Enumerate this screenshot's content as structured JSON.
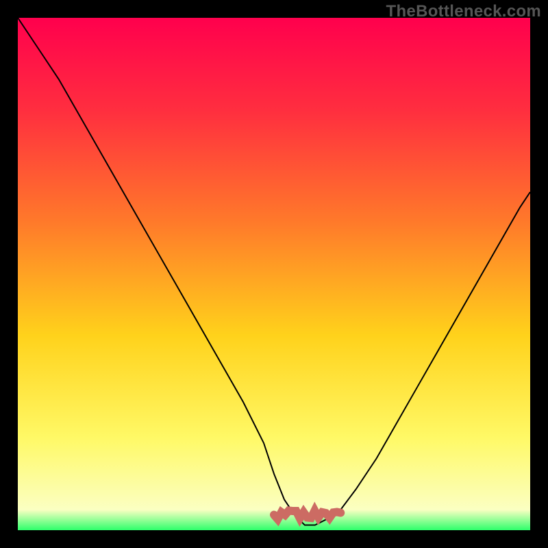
{
  "watermark": "TheBottleneck.com",
  "chart_data": {
    "type": "line",
    "title": "",
    "xlabel": "",
    "ylabel": "",
    "xlim": [
      0,
      100
    ],
    "ylim": [
      0,
      100
    ],
    "gradient_stops": [
      {
        "offset": 0,
        "color": "#ff004d"
      },
      {
        "offset": 18,
        "color": "#ff2e3f"
      },
      {
        "offset": 40,
        "color": "#ff7a2a"
      },
      {
        "offset": 62,
        "color": "#ffd21b"
      },
      {
        "offset": 82,
        "color": "#fff966"
      },
      {
        "offset": 96,
        "color": "#fbffc2"
      },
      {
        "offset": 100,
        "color": "#2dff6b"
      }
    ],
    "series": [
      {
        "name": "bottleneck-curve",
        "color": "#000000",
        "x": [
          0,
          4,
          8,
          12,
          16,
          20,
          24,
          28,
          32,
          36,
          40,
          44,
          48,
          50,
          52,
          54,
          56,
          58,
          60,
          63,
          66,
          70,
          74,
          78,
          82,
          86,
          90,
          94,
          98,
          100
        ],
        "y": [
          100,
          94,
          88,
          81,
          74,
          67,
          60,
          53,
          46,
          39,
          32,
          25,
          17,
          11,
          6,
          3,
          1,
          1,
          2,
          4,
          8,
          14,
          21,
          28,
          35,
          42,
          49,
          56,
          63,
          66
        ]
      }
    ],
    "flat_range": {
      "x_start": 50,
      "x_end": 63,
      "y": 3,
      "color": "#cc6b63",
      "thickness": 2.5
    }
  }
}
